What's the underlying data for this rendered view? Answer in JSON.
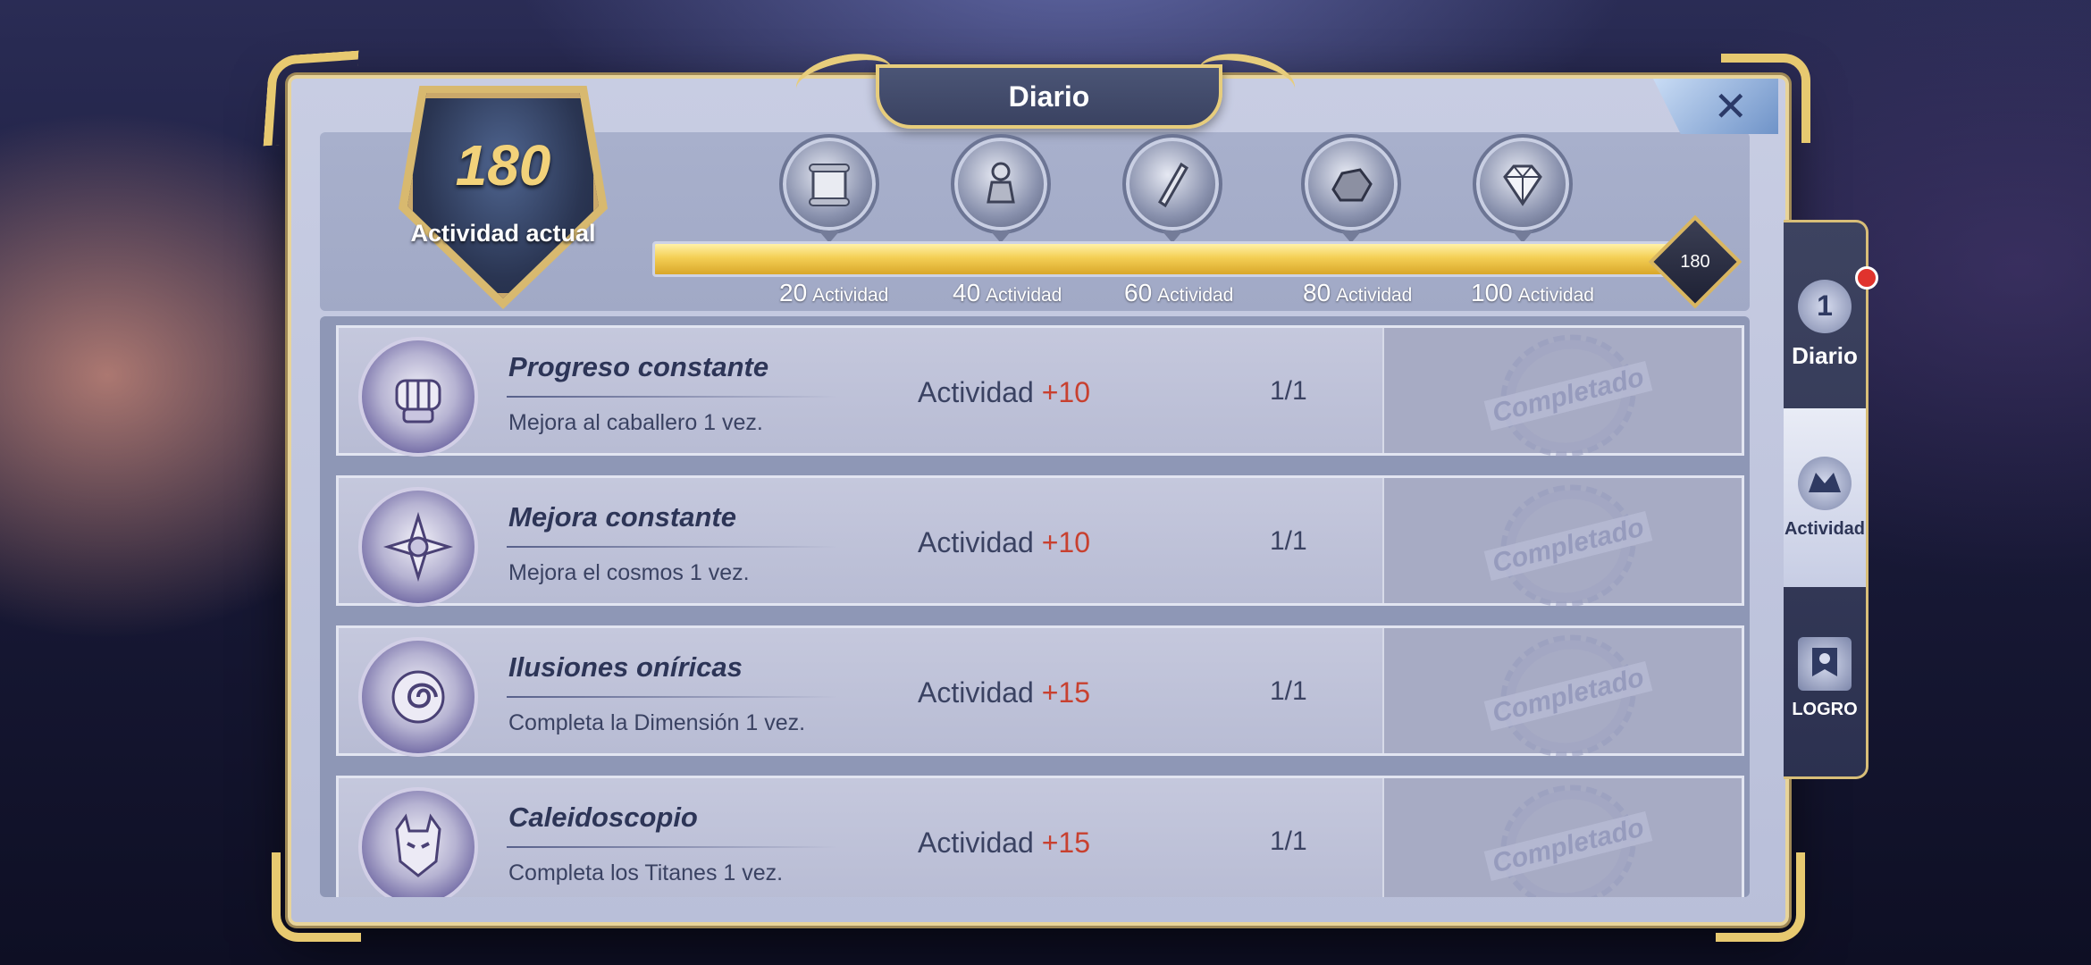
{
  "window": {
    "title": "Diario",
    "close_label": "✕"
  },
  "current_activity": {
    "value": "180",
    "label": "Actividad actual"
  },
  "milestones": [
    {
      "amount": "20",
      "unit": "Actividad",
      "icon": "scroll-icon"
    },
    {
      "amount": "40",
      "unit": "Actividad",
      "icon": "stone-chess-icon"
    },
    {
      "amount": "60",
      "unit": "Actividad",
      "icon": "crystal-rod-icon"
    },
    {
      "amount": "80",
      "unit": "Actividad",
      "icon": "ore-icon"
    },
    {
      "amount": "100",
      "unit": "Actividad",
      "icon": "diamond-icon"
    }
  ],
  "progress": {
    "end_value": "180",
    "fraction": 1.0
  },
  "tasks": [
    {
      "name": "Progreso constante",
      "desc": "Mejora al caballero 1 vez.",
      "reward_label": "Actividad",
      "reward_value": "+10",
      "count": "1/1",
      "status": "Completado",
      "icon": "fist-icon"
    },
    {
      "name": "Mejora constante",
      "desc": "Mejora el cosmos 1 vez.",
      "reward_label": "Actividad",
      "reward_value": "+10",
      "count": "1/1",
      "status": "Completado",
      "icon": "star-emblem-icon"
    },
    {
      "name": "Ilusiones oníricas",
      "desc": "Completa la Dimensión 1 vez.",
      "reward_label": "Actividad",
      "reward_value": "+15",
      "count": "1/1",
      "status": "Completado",
      "icon": "swirl-icon"
    },
    {
      "name": "Caleidoscopio",
      "desc": "Completa los Titanes 1 vez.",
      "reward_label": "Actividad",
      "reward_value": "+15",
      "count": "1/1",
      "status": "Completado",
      "icon": "titan-helmet-icon"
    }
  ],
  "side_tabs": [
    {
      "label": "Diario",
      "icon": "daily-badge-icon",
      "badge_glyph": "1",
      "active": false
    },
    {
      "label": "Actividad",
      "icon": "dragon-crest-icon",
      "active": true
    },
    {
      "label": "LOGRO",
      "icon": "banner-icon",
      "active": false
    }
  ],
  "colors": {
    "accent_gold": "#e7cd7c",
    "reward_red": "#c8402f",
    "progress_yellow": "#f4cf55"
  }
}
